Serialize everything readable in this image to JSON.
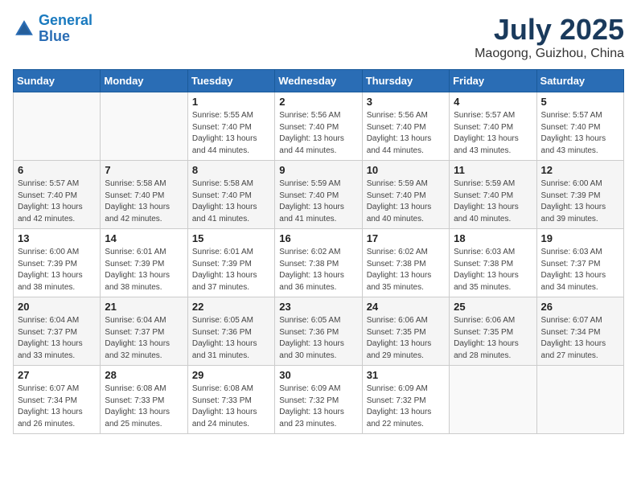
{
  "header": {
    "logo_line1": "General",
    "logo_line2": "Blue",
    "month_year": "July 2025",
    "location": "Maogong, Guizhou, China"
  },
  "days_of_week": [
    "Sunday",
    "Monday",
    "Tuesday",
    "Wednesday",
    "Thursday",
    "Friday",
    "Saturday"
  ],
  "weeks": [
    [
      {
        "day": null
      },
      {
        "day": null
      },
      {
        "day": 1,
        "sunrise": "5:55 AM",
        "sunset": "7:40 PM",
        "daylight": "13 hours and 44 minutes."
      },
      {
        "day": 2,
        "sunrise": "5:56 AM",
        "sunset": "7:40 PM",
        "daylight": "13 hours and 44 minutes."
      },
      {
        "day": 3,
        "sunrise": "5:56 AM",
        "sunset": "7:40 PM",
        "daylight": "13 hours and 44 minutes."
      },
      {
        "day": 4,
        "sunrise": "5:57 AM",
        "sunset": "7:40 PM",
        "daylight": "13 hours and 43 minutes."
      },
      {
        "day": 5,
        "sunrise": "5:57 AM",
        "sunset": "7:40 PM",
        "daylight": "13 hours and 43 minutes."
      }
    ],
    [
      {
        "day": 6,
        "sunrise": "5:57 AM",
        "sunset": "7:40 PM",
        "daylight": "13 hours and 42 minutes."
      },
      {
        "day": 7,
        "sunrise": "5:58 AM",
        "sunset": "7:40 PM",
        "daylight": "13 hours and 42 minutes."
      },
      {
        "day": 8,
        "sunrise": "5:58 AM",
        "sunset": "7:40 PM",
        "daylight": "13 hours and 41 minutes."
      },
      {
        "day": 9,
        "sunrise": "5:59 AM",
        "sunset": "7:40 PM",
        "daylight": "13 hours and 41 minutes."
      },
      {
        "day": 10,
        "sunrise": "5:59 AM",
        "sunset": "7:40 PM",
        "daylight": "13 hours and 40 minutes."
      },
      {
        "day": 11,
        "sunrise": "5:59 AM",
        "sunset": "7:40 PM",
        "daylight": "13 hours and 40 minutes."
      },
      {
        "day": 12,
        "sunrise": "6:00 AM",
        "sunset": "7:39 PM",
        "daylight": "13 hours and 39 minutes."
      }
    ],
    [
      {
        "day": 13,
        "sunrise": "6:00 AM",
        "sunset": "7:39 PM",
        "daylight": "13 hours and 38 minutes."
      },
      {
        "day": 14,
        "sunrise": "6:01 AM",
        "sunset": "7:39 PM",
        "daylight": "13 hours and 38 minutes."
      },
      {
        "day": 15,
        "sunrise": "6:01 AM",
        "sunset": "7:39 PM",
        "daylight": "13 hours and 37 minutes."
      },
      {
        "day": 16,
        "sunrise": "6:02 AM",
        "sunset": "7:38 PM",
        "daylight": "13 hours and 36 minutes."
      },
      {
        "day": 17,
        "sunrise": "6:02 AM",
        "sunset": "7:38 PM",
        "daylight": "13 hours and 35 minutes."
      },
      {
        "day": 18,
        "sunrise": "6:03 AM",
        "sunset": "7:38 PM",
        "daylight": "13 hours and 35 minutes."
      },
      {
        "day": 19,
        "sunrise": "6:03 AM",
        "sunset": "7:37 PM",
        "daylight": "13 hours and 34 minutes."
      }
    ],
    [
      {
        "day": 20,
        "sunrise": "6:04 AM",
        "sunset": "7:37 PM",
        "daylight": "13 hours and 33 minutes."
      },
      {
        "day": 21,
        "sunrise": "6:04 AM",
        "sunset": "7:37 PM",
        "daylight": "13 hours and 32 minutes."
      },
      {
        "day": 22,
        "sunrise": "6:05 AM",
        "sunset": "7:36 PM",
        "daylight": "13 hours and 31 minutes."
      },
      {
        "day": 23,
        "sunrise": "6:05 AM",
        "sunset": "7:36 PM",
        "daylight": "13 hours and 30 minutes."
      },
      {
        "day": 24,
        "sunrise": "6:06 AM",
        "sunset": "7:35 PM",
        "daylight": "13 hours and 29 minutes."
      },
      {
        "day": 25,
        "sunrise": "6:06 AM",
        "sunset": "7:35 PM",
        "daylight": "13 hours and 28 minutes."
      },
      {
        "day": 26,
        "sunrise": "6:07 AM",
        "sunset": "7:34 PM",
        "daylight": "13 hours and 27 minutes."
      }
    ],
    [
      {
        "day": 27,
        "sunrise": "6:07 AM",
        "sunset": "7:34 PM",
        "daylight": "13 hours and 26 minutes."
      },
      {
        "day": 28,
        "sunrise": "6:08 AM",
        "sunset": "7:33 PM",
        "daylight": "13 hours and 25 minutes."
      },
      {
        "day": 29,
        "sunrise": "6:08 AM",
        "sunset": "7:33 PM",
        "daylight": "13 hours and 24 minutes."
      },
      {
        "day": 30,
        "sunrise": "6:09 AM",
        "sunset": "7:32 PM",
        "daylight": "13 hours and 23 minutes."
      },
      {
        "day": 31,
        "sunrise": "6:09 AM",
        "sunset": "7:32 PM",
        "daylight": "13 hours and 22 minutes."
      },
      {
        "day": null
      },
      {
        "day": null
      }
    ]
  ]
}
